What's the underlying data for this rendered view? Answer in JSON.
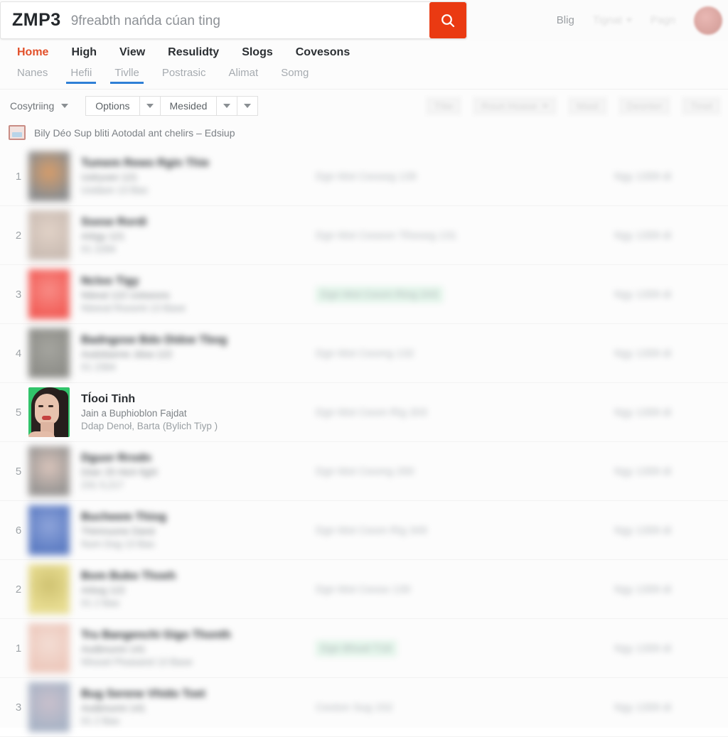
{
  "header": {
    "logo": "ZMP3",
    "search_value": "9freabth nańda cúan ting",
    "search_placeholder": "9freabth nańda cúan ting",
    "search_icon": "search-icon",
    "right_links": [
      {
        "label": "Blig",
        "dim": false
      },
      {
        "label": "Tignat",
        "dim": true,
        "dropdown": true
      },
      {
        "label": "Pagn",
        "dim": true
      }
    ],
    "avatar": "avatar"
  },
  "nav": {
    "primary": [
      {
        "label": "Home",
        "active": true
      },
      {
        "label": "High",
        "active": false
      },
      {
        "label": "View",
        "active": false
      },
      {
        "label": "Resulidty",
        "active": false
      },
      {
        "label": "Slogs",
        "active": false
      },
      {
        "label": "Covesons",
        "active": false
      }
    ],
    "secondary": [
      {
        "label": "Nanes",
        "underline": false
      },
      {
        "label": "Hefii",
        "underline": true
      },
      {
        "label": "Tivlle",
        "underline": true
      },
      {
        "label": "Postrasic",
        "underline": false
      },
      {
        "label": "Alimat",
        "underline": false
      },
      {
        "label": "Somg",
        "underline": false
      }
    ]
  },
  "toolbar": {
    "sort_label": "Cosytriing",
    "options_label": "Options",
    "mesided_label": "Mesided",
    "right_items": [
      {
        "label": "Tlite",
        "dropdown": false
      },
      {
        "label": "Roun Hoase",
        "dropdown": true
      },
      {
        "label": "Mast",
        "dropdown": false
      },
      {
        "label": "Deonter",
        "dropdown": false
      },
      {
        "label": "Tinet",
        "dropdown": false
      }
    ]
  },
  "notice": {
    "icon": "image-icon",
    "text": "Bily Déo Sup bliti Aotodal ant chelirs – Edsiup"
  },
  "list": {
    "rows": [
      {
        "rank": "1",
        "thumb_color": "#8e8e8e",
        "thumb_accent": "#d79d6a",
        "blurred": true,
        "title": "Tumem Rewo Rgin Thie",
        "subtitle": "Uolryven   121",
        "meta": "Uodaon   13 Bao",
        "mid": "Dgn Mot Ceoseg  139",
        "mid_highlight": false,
        "right": "Ngy 1399  di"
      },
      {
        "rank": "2",
        "thumb_color": "#cbbdb4",
        "thumb_accent": "#e1d2c7",
        "blurred": true,
        "title": "Ssese Rordi",
        "subtitle": "Arbgy   121",
        "meta": "01 2284",
        "mid": "Dgn Mot Ceseon Tiheseg  131",
        "mid_highlight": false,
        "right": "Ngy 1399  di"
      },
      {
        "rank": "3",
        "thumb_color": "#f2605a",
        "thumb_accent": "#f88c86",
        "blurred": true,
        "title": "Ncloo Tigy",
        "subtitle": "Nitesd   122   Uoloesns",
        "meta": "Nteesd   Roosmt   13 Baoe",
        "mid": "Dgn Mot Ceom Ring  243",
        "mid_highlight": true,
        "right": "Ngy 1399  di"
      },
      {
        "rank": "4",
        "thumb_color": "#8f8f8a",
        "thumb_accent": "#a5a59f",
        "blurred": true,
        "title": "Badngose Bdo Didoe Tbog",
        "subtitle": "Aodobanne   Jdoa   122",
        "meta": "01 2364",
        "mid": "Dgn Mot Ceomg  132",
        "mid_highlight": false,
        "right": "Ngy 1399  di"
      },
      {
        "rank": "5",
        "thumb_color": "#31c46a",
        "thumb_accent": "#e8c3ae",
        "blurred": false,
        "title": "Tĺooi Tinh",
        "subtitle": "Jain a Buphioblon Fajdat",
        "meta": "Ddap Denoł, Barta  (Bylich Tiyp )",
        "mid": "Dgn Mot Ceom Rig  203",
        "mid_highlight": false,
        "right": "Ngy 1399  di"
      },
      {
        "rank": "5",
        "thumb_color": "#9b9896",
        "thumb_accent": "#d9c4bb",
        "blurred": true,
        "title": "Dguor Rrodn",
        "subtitle": "Dóer 25 Hich fighl",
        "meta": "231 5,217",
        "mid": "Dgn Mot Ceomg  290",
        "mid_highlight": false,
        "right": "Ngy 1399  di"
      },
      {
        "rank": "6",
        "thumb_color": "#5f7ec4",
        "thumb_accent": "#8ea4da",
        "blurred": true,
        "title": "Bucheem Thiog",
        "subtitle": "Thimnuone   Dand",
        "meta": "Num  Dog  13 Bao",
        "mid": "Dgn Mot Ceom Rig  349",
        "mid_highlight": false,
        "right": "Ngy 1399  di"
      },
      {
        "rank": "2",
        "thumb_color": "#e8dd92",
        "thumb_accent": "#cfc271",
        "blurred": true,
        "title": "Bom Bubo Thoeh",
        "subtitle": "Arbog   122",
        "meta": "01 2 Bao",
        "mid": "Dgn Mot Ceoso  130",
        "mid_highlight": false,
        "right": "Ngy 1399  di"
      },
      {
        "rank": "1",
        "thumb_color": "#edc9bd",
        "thumb_accent": "#f3ddd4",
        "blurred": true,
        "title": "Tru Bangenchi Gigo Thonth",
        "subtitle": "Aodbnunni   141",
        "meta": "Nhooel   Ploasand   13 Baoe",
        "mid": "Dgn Bhoel  T16",
        "mid_highlight": true,
        "right": "Ngy 1399  di"
      },
      {
        "rank": "3",
        "thumb_color": "#aab4c6",
        "thumb_accent": "#c9c0cc",
        "blurred": true,
        "title": "Bug Serene Vhido Toet",
        "subtitle": "Aodbnunni   141",
        "meta": "01 2 Bao",
        "mid": "Ceoton  Sug  152",
        "mid_highlight": false,
        "right": "Ngy 1399  di"
      }
    ]
  }
}
